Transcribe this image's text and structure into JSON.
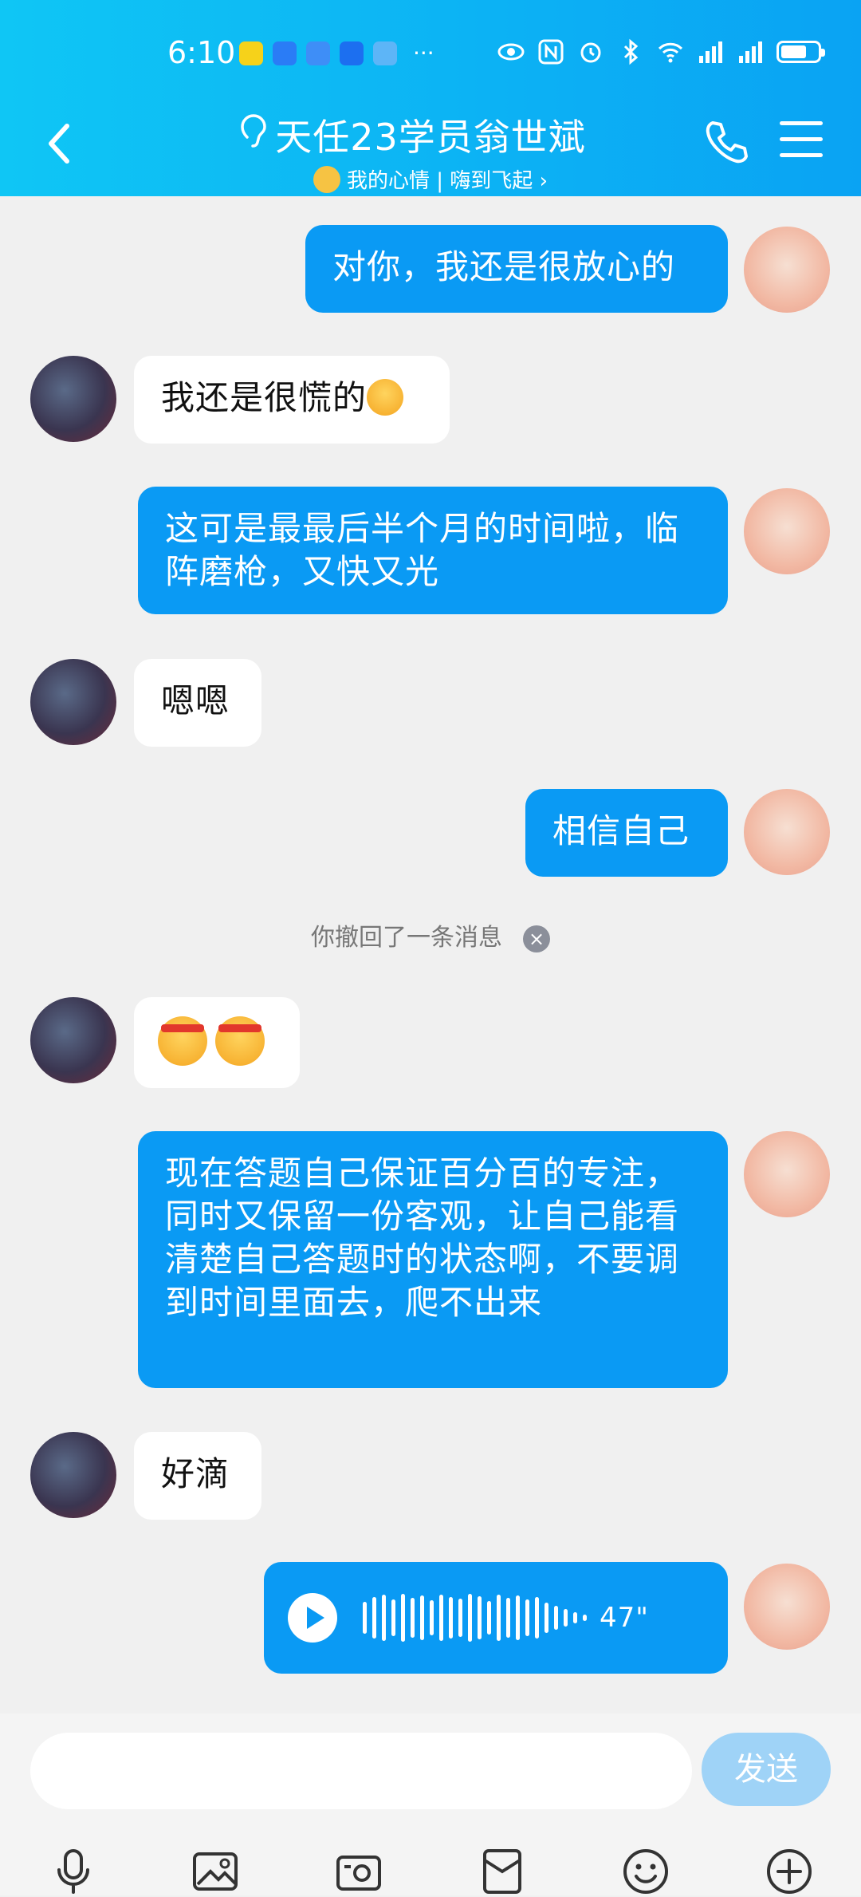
{
  "status_bar": {
    "time": "6:10",
    "more": "···",
    "battery_level": 0.7
  },
  "header": {
    "title": "天任23学员翁世斌",
    "subtitle": "我的心情 | 嗨到飞起 ›"
  },
  "messages": [
    {
      "side": "out",
      "text": "对你，我还是很放心的"
    },
    {
      "side": "in",
      "text": "我还是很慌的"
    },
    {
      "side": "out",
      "text": "这可是最最后半个月的时间啦，临阵磨枪，又快又光"
    },
    {
      "side": "in",
      "text": "嗯嗯"
    },
    {
      "side": "out",
      "text": "相信自己"
    },
    {
      "side": "in",
      "text": ""
    },
    {
      "side": "out",
      "text": "现在答题自己保证百分百的专注，同时又保留一份客观，让自己能看清楚自己答题时的状态啊，不要调到时间里面去，爬不出来"
    },
    {
      "side": "in",
      "text": "好滴"
    },
    {
      "side": "out",
      "type": "voice",
      "duration": "47\""
    }
  ],
  "recall_notice": "你撤回了一条消息",
  "recall_close": "×",
  "input": {
    "placeholder": "",
    "send_label": "发送"
  },
  "toolbar": [
    "mic-icon",
    "image-icon",
    "camera-icon",
    "red-packet-icon",
    "emoji-icon",
    "plus-icon"
  ]
}
